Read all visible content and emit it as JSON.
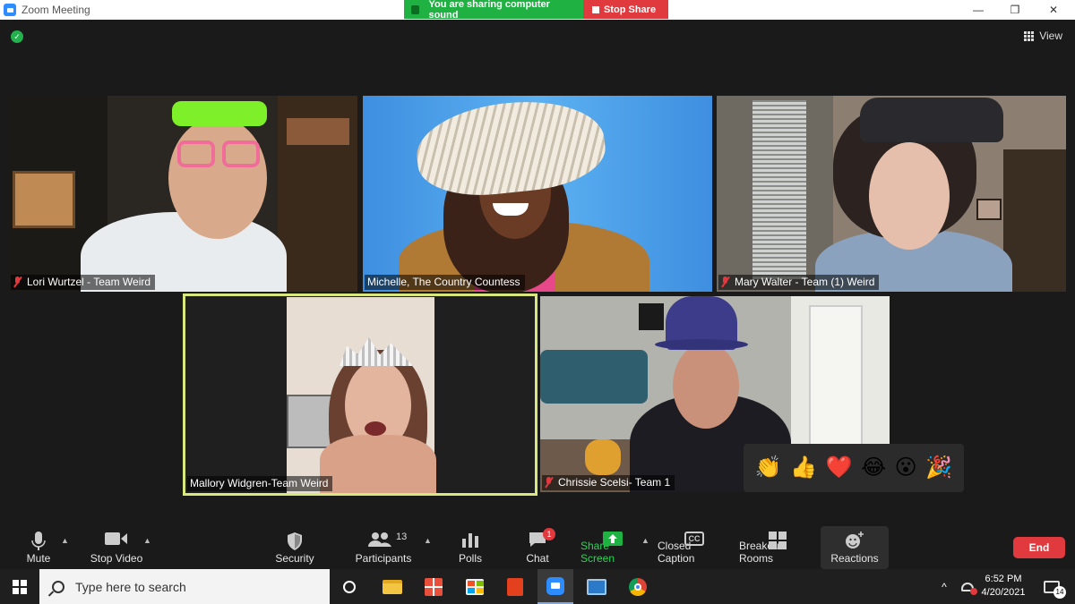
{
  "window": {
    "title": "Zoom Meeting",
    "minimize": "—",
    "restore": "❐",
    "close": "✕"
  },
  "share_banner": {
    "status": "You are sharing computer sound",
    "stop_label": "Stop Share"
  },
  "view_button": {
    "label": "View"
  },
  "participants_tiles": [
    {
      "name": "Lori Wurtzel - Team Weird",
      "muted": true
    },
    {
      "name": "Michelle, The Country Countess",
      "muted": false
    },
    {
      "name": "Mary Walter - Team (1) Weird",
      "muted": true
    },
    {
      "name": "Mallory Widgren-Team Weird",
      "muted": false,
      "active_speaker": true
    },
    {
      "name": "Chrissie Scelsi- Team 1",
      "muted": true
    }
  ],
  "reactions_popup": [
    "👏",
    "👍",
    "❤️",
    "😂",
    "😮",
    "🎉"
  ],
  "toolbar": {
    "mute": "Mute",
    "stop_video": "Stop Video",
    "security": "Security",
    "participants": "Participants",
    "participants_count": "13",
    "polls": "Polls",
    "chat": "Chat",
    "chat_badge": "1",
    "share_screen": "Share Screen",
    "closed_caption": "Closed Caption",
    "cc_icon": "CC",
    "breakout_rooms": "Breakout Rooms",
    "reactions": "Reactions",
    "end": "End"
  },
  "taskbar": {
    "search_placeholder": "Type here to search",
    "time": "6:52 PM",
    "date": "4/20/2021",
    "notification_count": "14",
    "chevron": "^"
  },
  "colors": {
    "share_green": "#1fb141",
    "stop_red": "#e0393e",
    "active_speaker_border": "#d9e77f",
    "zoom_blue": "#2d8cff"
  }
}
